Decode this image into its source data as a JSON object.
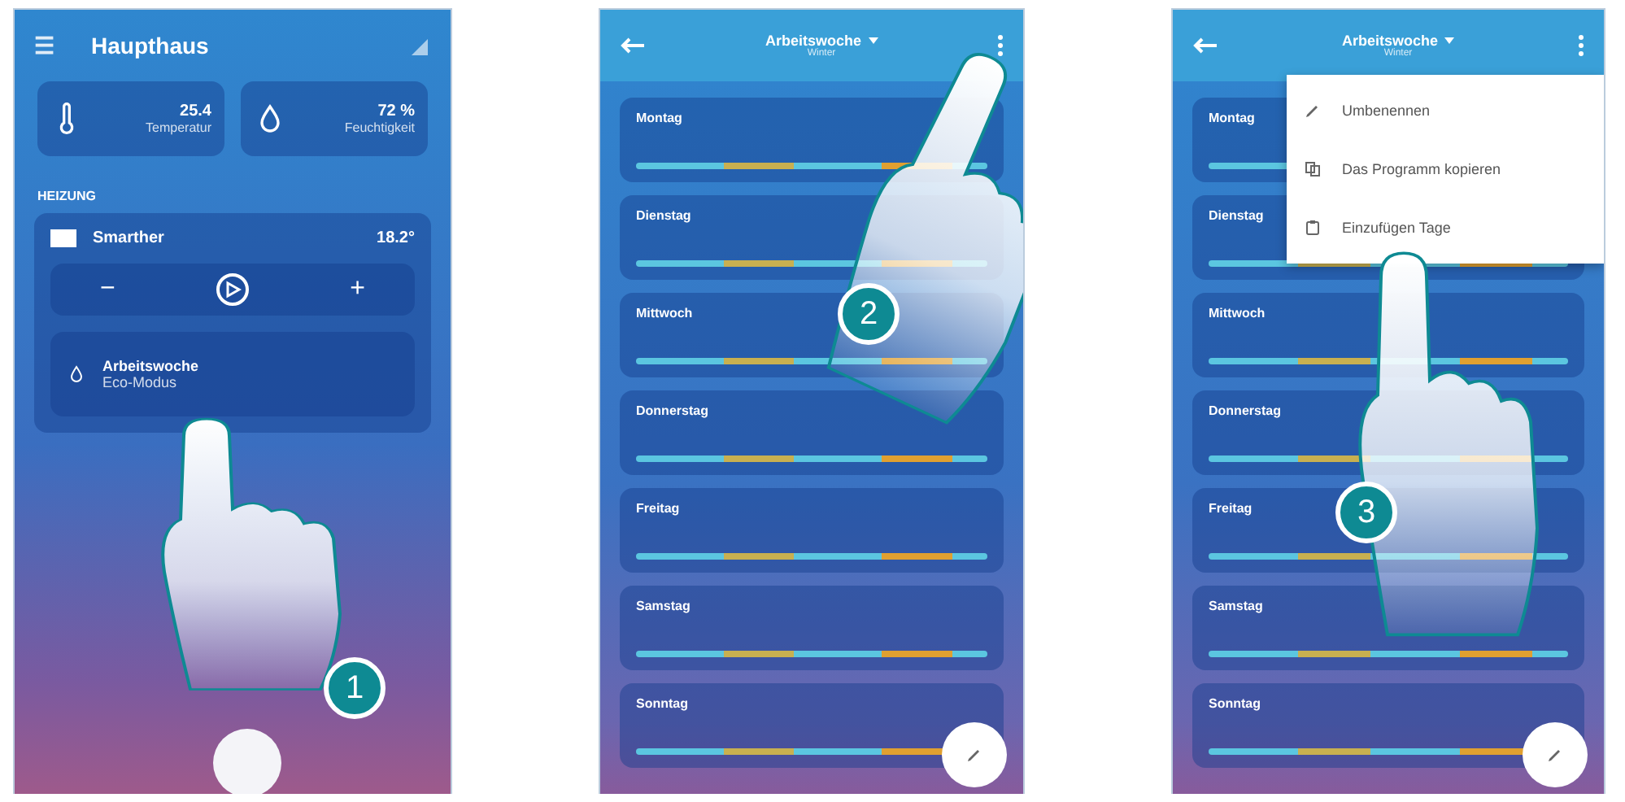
{
  "screens": [
    {
      "kind": "home",
      "menu_icon": "☰",
      "title": "Haupthaus",
      "sensors": [
        {
          "kind": "temperature",
          "value": "25.4",
          "label": "Temperatur"
        },
        {
          "kind": "humidity",
          "value": "72 %",
          "label": "Feuchtigkeit"
        }
      ],
      "section": "HEIZUNG",
      "thermostat": {
        "name": "Smarther",
        "reading": "18.2°",
        "minus": "−",
        "plus": "+"
      },
      "program": {
        "name": "Arbeitswoche",
        "status": "Eco-Modus"
      },
      "step": "1"
    },
    {
      "kind": "week",
      "title": "Arbeitswoche",
      "subtitle": "Winter",
      "days": [
        "Montag",
        "Dienstag",
        "Mittwoch",
        "Donnerstag",
        "Freitag",
        "Samstag",
        "Sonntag"
      ],
      "step": "2"
    },
    {
      "kind": "week",
      "title": "Arbeitswoche",
      "subtitle": "Winter",
      "days": [
        "Montag",
        "Dienstag",
        "Mittwoch",
        "Donnerstag",
        "Freitag",
        "Samstag",
        "Sonntag"
      ],
      "menu": [
        {
          "kind": "rename",
          "label": "Umbenennen"
        },
        {
          "kind": "copy",
          "label": "Das Programm kopieren"
        },
        {
          "kind": "paste",
          "label": "Einzufügen Tage"
        }
      ],
      "step": "3"
    }
  ]
}
